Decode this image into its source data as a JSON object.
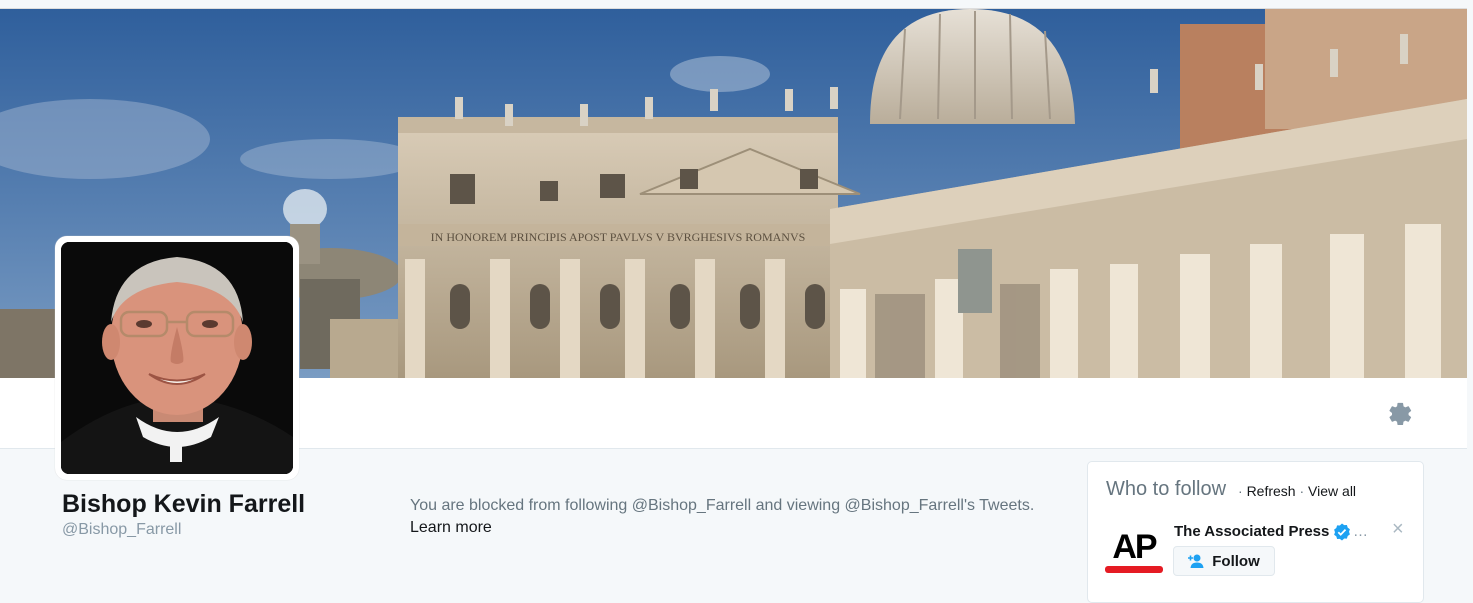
{
  "profile": {
    "name": "Bishop Kevin Farrell",
    "handle": "@Bishop_Farrell"
  },
  "blocked_notice": {
    "message": "You are blocked from following @Bishop_Farrell and viewing @Bishop_Farrell's Tweets.",
    "learn_more": "Learn more"
  },
  "banner": {
    "inscription": "IN HONOREM PRINCIPIS APOST PAVLVS V BVRGHESIVS ROMANVS"
  },
  "who_to_follow": {
    "title": "Who to follow",
    "separator": "·",
    "refresh": "Refresh",
    "view_all": "View all",
    "suggestion": {
      "logo_text": "AP",
      "name": "The Associated Press",
      "ellipsis": "…",
      "follow_label": "Follow",
      "dismiss": "×"
    }
  },
  "icons": {
    "settings": "gear-icon",
    "verified": "verified-badge-icon",
    "follow": "add-user-icon"
  },
  "colors": {
    "sky": "#3d6fa8",
    "stone": "#cdbca3",
    "ap_red": "#e51b23",
    "verified_blue": "#1da1f2",
    "accent_follow": "#1da1f2"
  }
}
